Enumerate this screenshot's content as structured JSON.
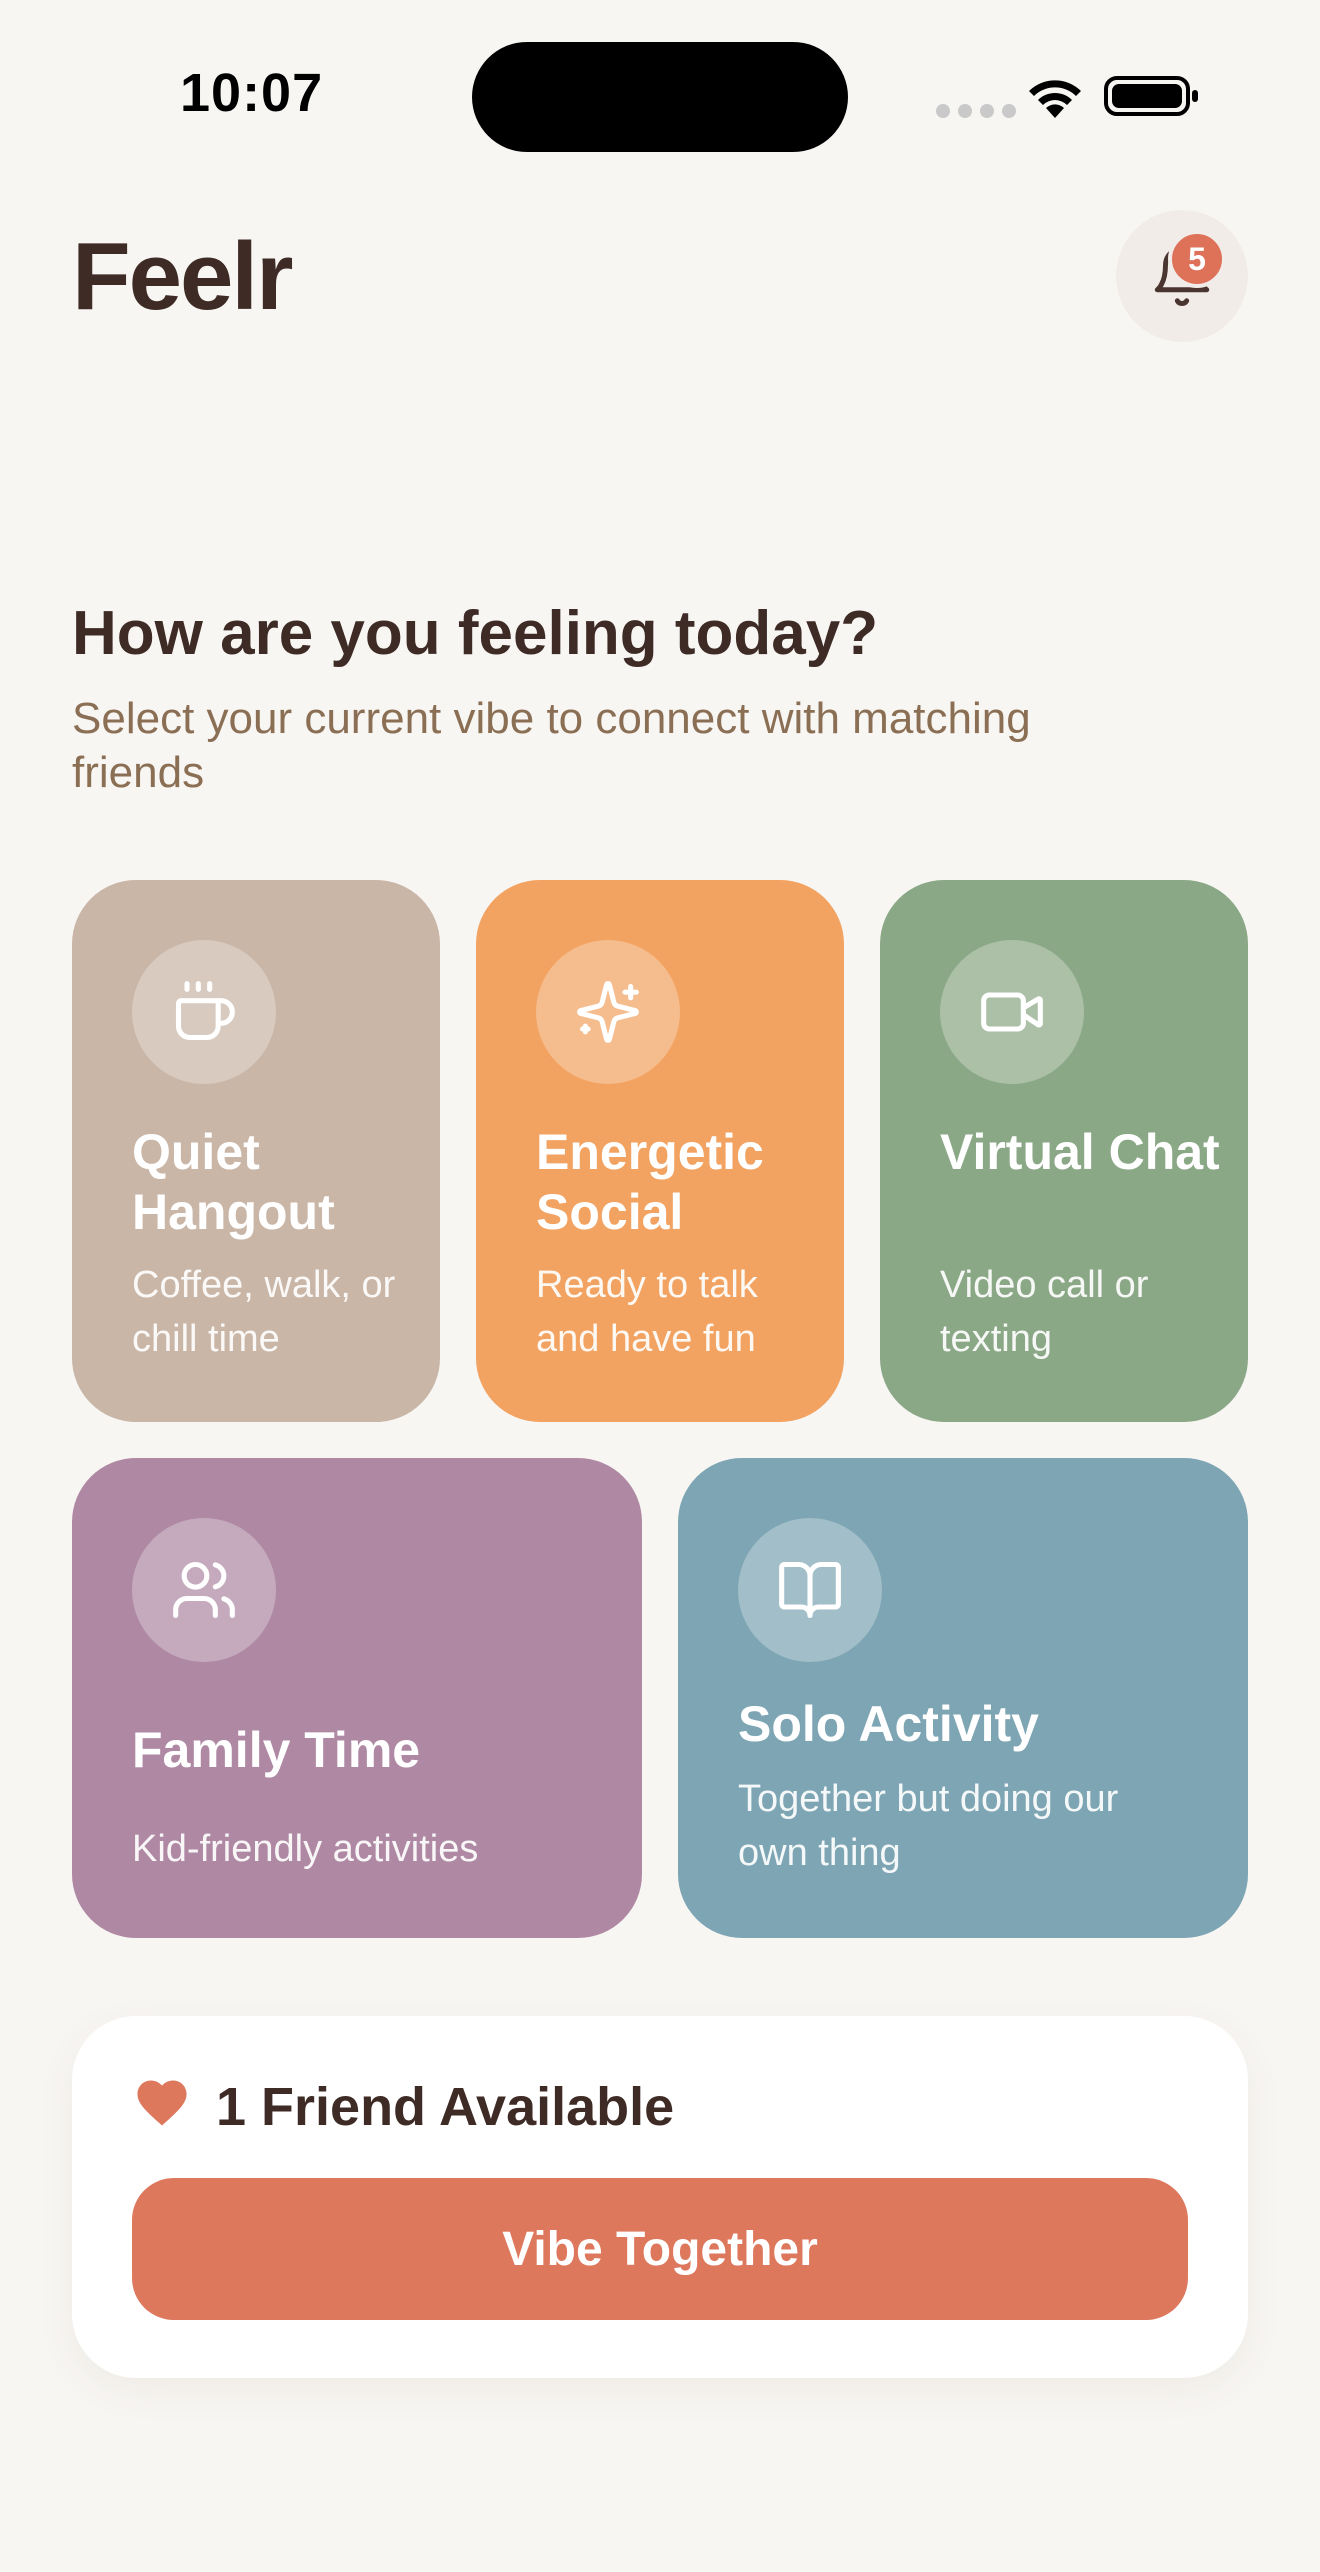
{
  "status_bar": {
    "time": "10:07"
  },
  "header": {
    "app_title": "Feelr",
    "notification_count": "5"
  },
  "prompt": {
    "question": "How are you feeling today?",
    "subtitle": "Select your current vibe to connect with matching friends"
  },
  "vibes": [
    {
      "title": "Quiet Hangout",
      "description": "Coffee, walk, or chill time",
      "icon": "coffee-cup-icon",
      "color": "#C9B6A7"
    },
    {
      "title": "Energetic Social",
      "description": "Ready to talk and have fun",
      "icon": "sparkles-icon",
      "color": "#F2A261"
    },
    {
      "title": "Virtual Chat",
      "description": "Video call or texting",
      "icon": "video-camera-icon",
      "color": "#8BA886"
    },
    {
      "title": "Family Time",
      "description": "Kid-friendly activities",
      "icon": "users-icon",
      "color": "#AF89A4"
    },
    {
      "title": "Solo Activity",
      "description": "Together but doing our own thing",
      "icon": "book-open-icon",
      "color": "#7DA5B4"
    }
  ],
  "friends_panel": {
    "available_text": "1 Friend Available",
    "button_label": "Vibe Together",
    "accent_color": "#DE785D"
  }
}
